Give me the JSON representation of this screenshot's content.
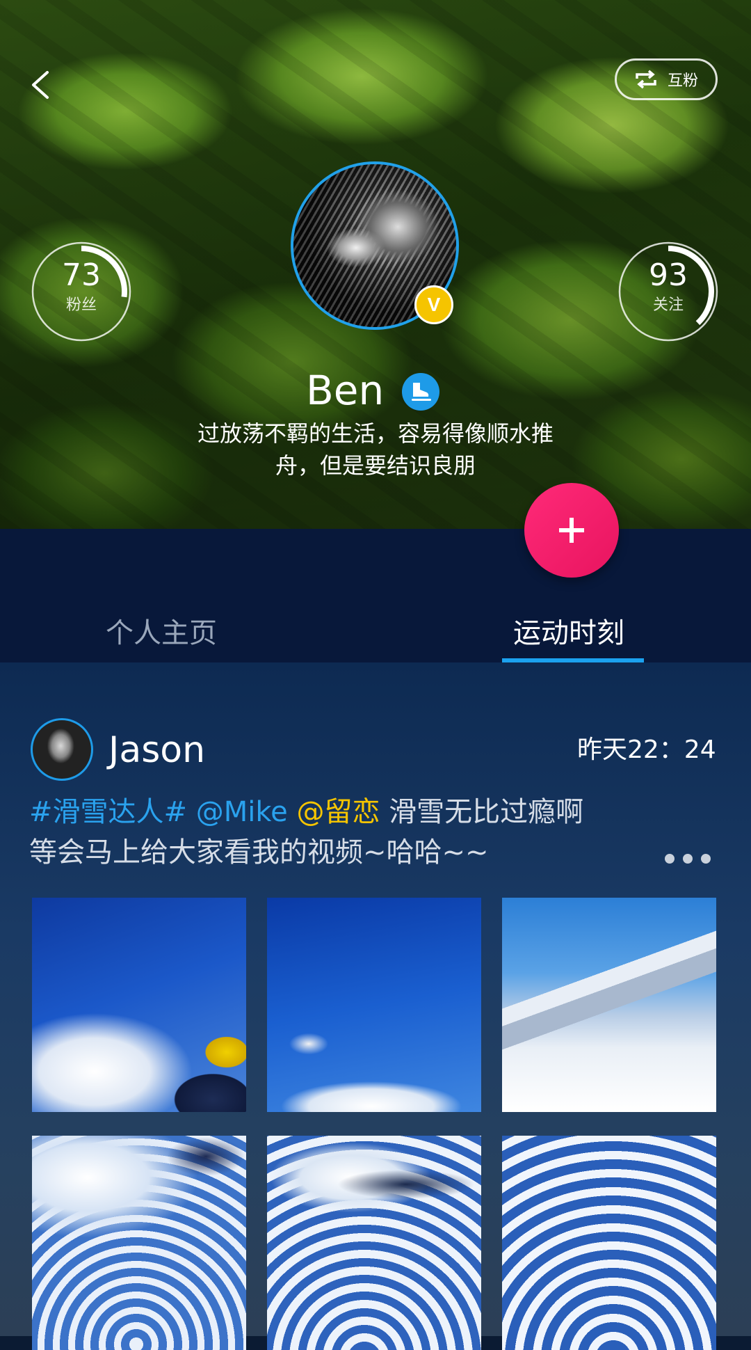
{
  "header": {
    "mutual_label": "互粉",
    "fans": {
      "count": "73",
      "label": "粉丝",
      "progress": 0.27
    },
    "following": {
      "count": "93",
      "label": "关注",
      "progress": 0.38
    },
    "badge_letter": "V",
    "username": "Ben",
    "bio": "过放荡不羁的生活，容易得像顺水推舟，但是要结识良朋"
  },
  "tabs": [
    {
      "label": "个人主页",
      "active": false
    },
    {
      "label": "运动时刻",
      "active": true
    }
  ],
  "post": {
    "author": "Jason",
    "time": "昨天22：24",
    "topic": "#滑雪达人#",
    "mention1": "@Mike",
    "mention2": "@留恋",
    "body": "滑雪无比过瘾啊等会马上给大家看我的视频~哈哈~~",
    "photos": [
      "ski-photo-1",
      "ski-photo-2",
      "ski-photo-3",
      "ski-photo-4",
      "ski-photo-5",
      "ski-photo-6"
    ]
  },
  "colors": {
    "accent_blue": "#1ba2ef",
    "fab_pink": "#ff2a78",
    "vip_yellow": "#f5c400",
    "tab_bg": "#08183a"
  },
  "icons": {
    "back": "chevron-left-icon",
    "mutual": "repeat-icon",
    "sport": "ice-skate-icon",
    "fab": "plus-icon",
    "more": "more-dots-icon"
  }
}
